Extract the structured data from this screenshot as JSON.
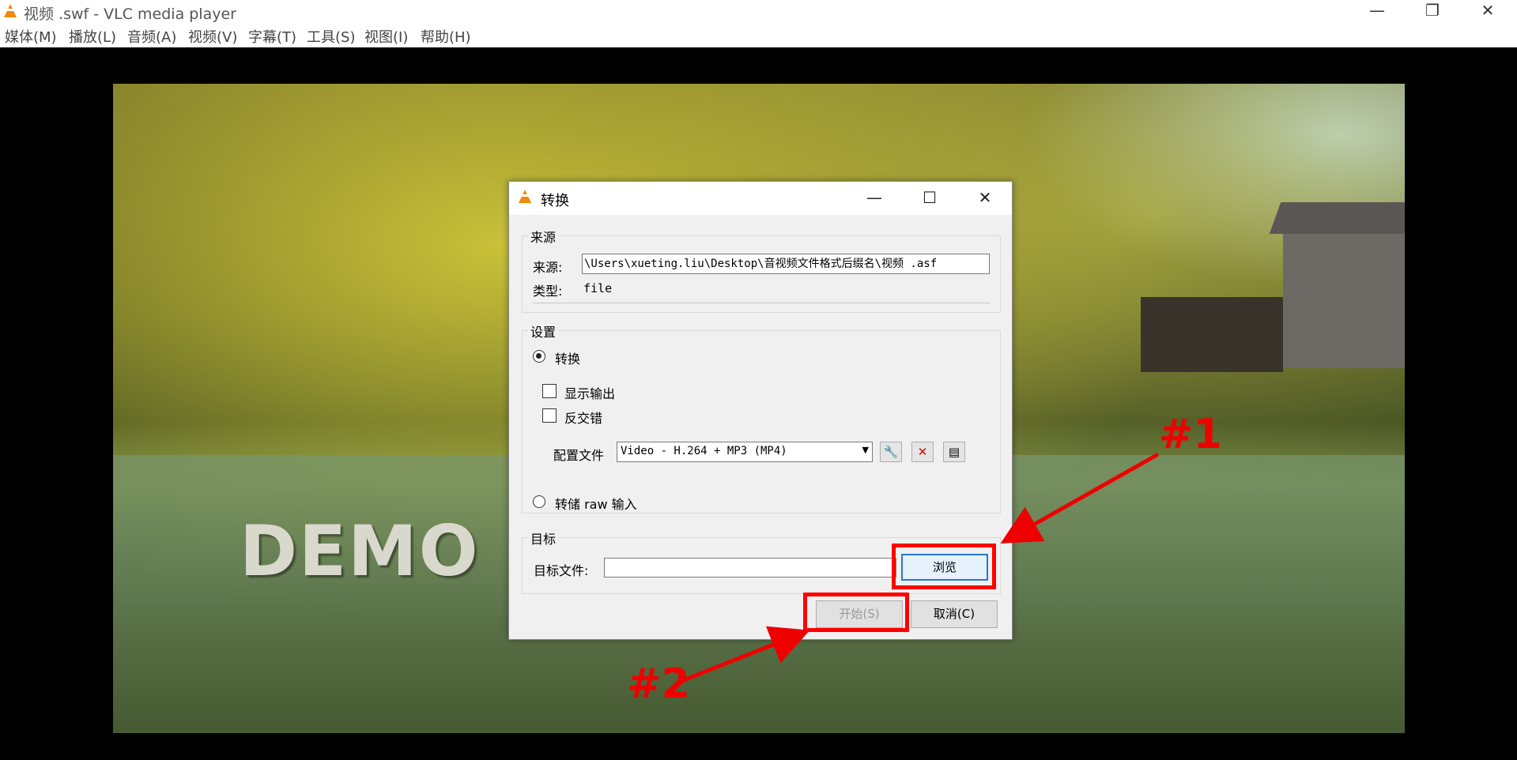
{
  "window": {
    "title": "视频 .swf - VLC media player",
    "minimize": "—",
    "maximize": "❐",
    "close": "✕"
  },
  "menu": [
    {
      "label": "媒体(M)"
    },
    {
      "label": "播放(L)"
    },
    {
      "label": "音频(A)"
    },
    {
      "label": "视频(V)"
    },
    {
      "label": "字幕(T)"
    },
    {
      "label": "工具(S)"
    },
    {
      "label": "视图(I)"
    },
    {
      "label": "帮助(H)"
    }
  ],
  "video": {
    "watermark": "DEMO"
  },
  "dialog": {
    "title": "转换",
    "source_group": "来源",
    "source_label": "来源:",
    "source_value": "\\Users\\xueting.liu\\Desktop\\音视频文件格式后缀名\\视频 .asf",
    "type_label": "类型:",
    "type_value": "file",
    "settings_group": "设置",
    "convert_label": "转换",
    "show_output_label": "显示输出",
    "deinterlace_label": "反交错",
    "profile_label": "配置文件",
    "profile_value": "Video - H.264 + MP3 (MP4)",
    "dump_raw_label": "转储 raw 输入",
    "dest_group": "目标",
    "dest_label": "目标文件:",
    "dest_value": "",
    "browse": "浏览",
    "start": "开始(S)",
    "cancel": "取消(C)"
  },
  "annotations": {
    "one": "#1",
    "two": "#2"
  },
  "colors": {
    "annotation": "#ff0000",
    "vlc_orange": "#f08a0c"
  }
}
